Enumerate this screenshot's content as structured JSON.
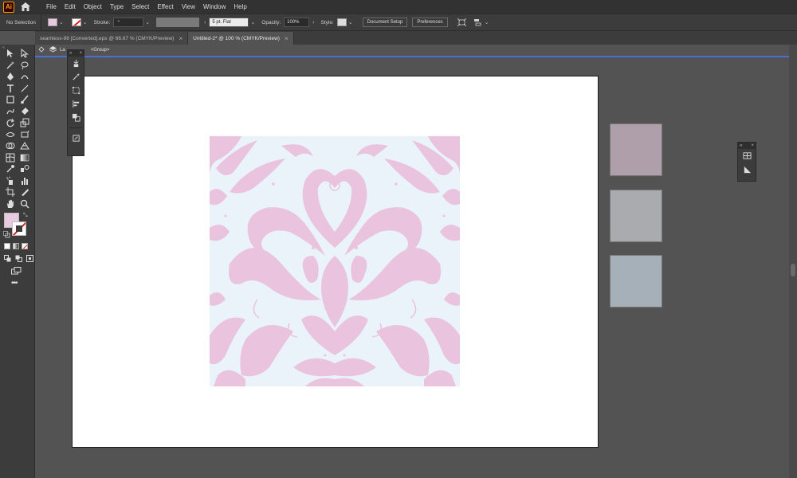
{
  "app": {
    "logo_text": "Ai"
  },
  "menu": [
    "File",
    "Edit",
    "Object",
    "Type",
    "Select",
    "Effect",
    "View",
    "Window",
    "Help"
  ],
  "controlbar": {
    "selection_label": "No Selection",
    "stroke_label": "Stroke:",
    "brush_value": "5 pt. Flat",
    "opacity_label": "Opacity:",
    "opacity_value": "100%",
    "style_label": "Style:",
    "document_setup": "Document Setup",
    "preferences": "Preferences"
  },
  "tabs": [
    {
      "label": "seamless-98 [Converted].eps @ 66.67 % (CMYK/Preview)",
      "active": false
    },
    {
      "label": "Untitled-2* @ 100 % (CMYK/Preview)",
      "active": true
    }
  ],
  "isolation": {
    "layer": "La",
    "group": "<Group>"
  },
  "colors": {
    "fill": "#e9c9e0",
    "pattern_motif": "#eac4df",
    "pattern_bg": "#eaf3f9",
    "swatch_1": "#ae9fab",
    "swatch_2": "#a9abaf",
    "swatch_3": "#a5b0b8"
  },
  "icons": {
    "toolbar": [
      "selection-tool",
      "direct-selection-tool",
      "magic-wand-tool",
      "lasso-tool",
      "pen-tool",
      "curvature-tool",
      "type-tool",
      "line-tool",
      "rectangle-tool",
      "paintbrush-tool",
      "shaper-tool",
      "eraser-tool",
      "rotate-tool",
      "scale-tool",
      "width-tool",
      "free-transform-tool",
      "shape-builder-tool",
      "perspective-grid-tool",
      "mesh-tool",
      "gradient-tool",
      "eyedropper-tool",
      "blend-tool",
      "symbol-sprayer-tool",
      "column-graph-tool",
      "artboard-tool",
      "slice-tool",
      "hand-tool",
      "zoom-tool"
    ]
  }
}
